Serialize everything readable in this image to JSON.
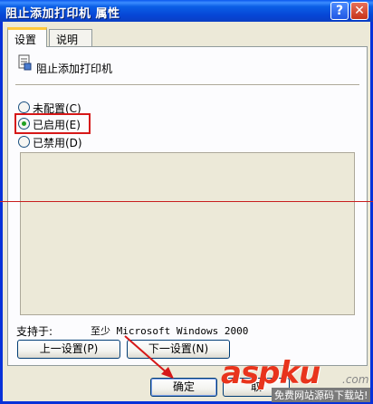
{
  "window": {
    "title": "阻止添加打印机 属性",
    "help_glyph": "?",
    "close_glyph": "✕"
  },
  "tabs": [
    {
      "label": "设置"
    },
    {
      "label": "说明"
    }
  ],
  "policy": {
    "name": "阻止添加打印机",
    "icon": "policy-setting-icon"
  },
  "options": [
    {
      "label": "未配置(C)",
      "selected": false
    },
    {
      "label": "已启用(E)",
      "selected": true
    },
    {
      "label": "已禁用(D)",
      "selected": false
    }
  ],
  "support": {
    "label": "支持于:",
    "value": "至少 Microsoft Windows 2000"
  },
  "buttons": {
    "prev": "上一设置(P)",
    "next": "下一设置(N)",
    "ok": "确定",
    "cancel": "取"
  },
  "watermark": {
    "logo": "aspku",
    "tld": ".com",
    "sub": "免费网站源码下载站!"
  },
  "colors": {
    "titlebar": "#0a58ee",
    "highlight": "#d61818",
    "selected_radio": "#21a121"
  }
}
